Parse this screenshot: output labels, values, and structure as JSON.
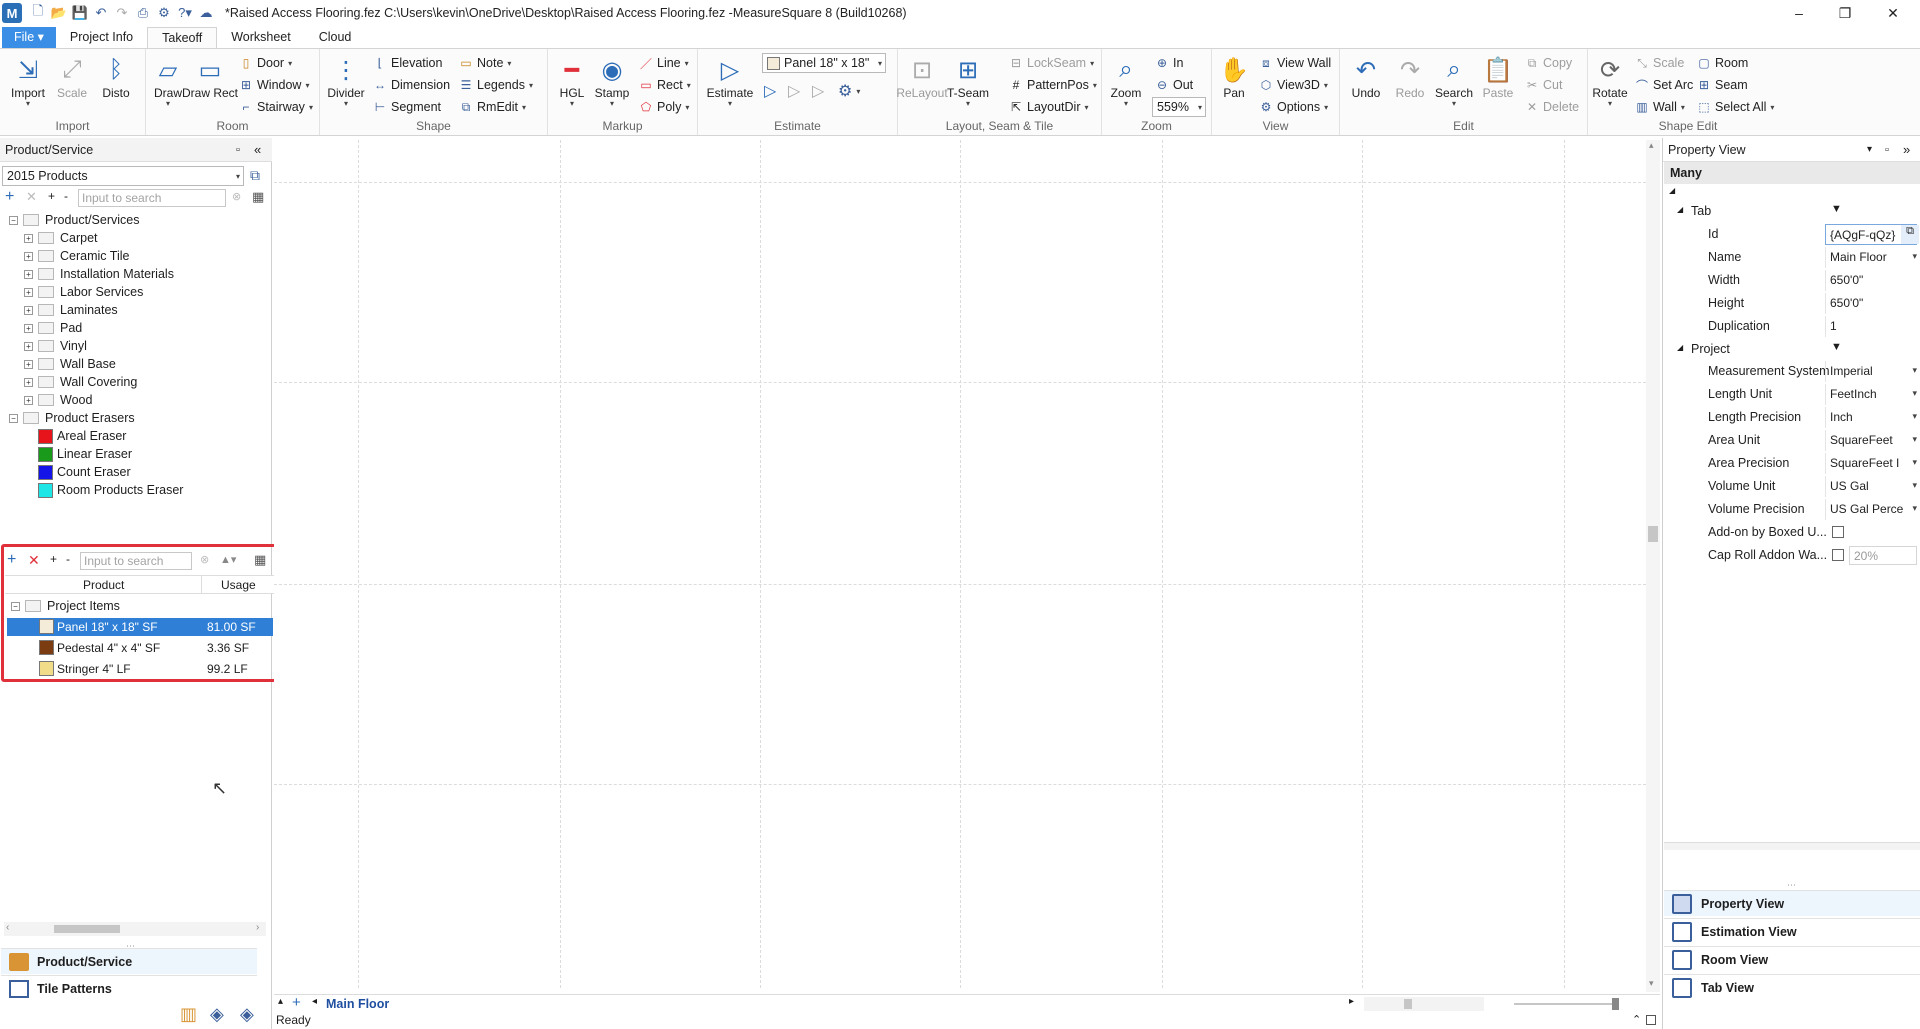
{
  "window": {
    "title": "*Raised Access Flooring.fez C:\\Users\\kevin\\OneDrive\\Desktop\\Raised Access Flooring.fez -MeasureSquare 8 (Build10268)",
    "app_icon": "M"
  },
  "menu": {
    "file": "File ▾",
    "tabs": [
      "Project Info",
      "Takeoff",
      "Worksheet",
      "Cloud"
    ]
  },
  "ribbon": {
    "import": {
      "import": "Import",
      "scale": "Scale",
      "disto": "Disto",
      "group": "Import"
    },
    "room": {
      "draw": "Draw",
      "draw_rect": "Draw Rect",
      "door": "Door",
      "window": "Window",
      "stairway": "Stairway",
      "group": "Room"
    },
    "shape": {
      "divider": "Divider",
      "elevation": "Elevation",
      "dimension": "Dimension",
      "segment": "Segment",
      "note": "Note",
      "legends": "Legends",
      "rmedit": "RmEdit",
      "group": "Shape"
    },
    "markup": {
      "hgl": "HGL",
      "stamp": "Stamp",
      "line": "Line",
      "rect": "Rect",
      "poly": "Poly",
      "group": "Markup"
    },
    "estimate": {
      "estimate": "Estimate",
      "product_combo": "Panel 18\" x 18\"",
      "group": "Estimate"
    },
    "layout": {
      "relayout": "ReLayout",
      "tseam": "T-Seam",
      "lockseam": "LockSeam",
      "patternpos": "PatternPos",
      "layoutdir": "LayoutDir",
      "group": "Layout, Seam & Tile"
    },
    "zoom": {
      "zoom": "Zoom",
      "in": "In",
      "out": "Out",
      "level": "559%",
      "group": "Zoom"
    },
    "view": {
      "pan": "Pan",
      "view_wall": "View Wall",
      "view3d": "View3D",
      "options": "Options",
      "group": "View"
    },
    "edit": {
      "undo": "Undo",
      "redo": "Redo",
      "search": "Search",
      "paste": "Paste",
      "copy": "Copy",
      "cut": "Cut",
      "delete": "Delete",
      "group": "Edit"
    },
    "shape_edit": {
      "rotate": "Rotate",
      "scale": "Scale",
      "set_arc": "Set Arc",
      "wall": "Wall",
      "room": "Room",
      "seam": "Seam",
      "select_all": "Select All",
      "group": "Shape Edit"
    }
  },
  "left_pane": {
    "title": "Product/Service",
    "catalog": "2015 Products",
    "search_placeholder": "Input to search",
    "tree_root": "Product/Services",
    "categories": [
      "Carpet",
      "Ceramic Tile",
      "Installation Materials",
      "Labor Services",
      "Laminates",
      "Pad",
      "Vinyl",
      "Wall Base",
      "Wall Covering",
      "Wood"
    ],
    "erasers_root": "Product Erasers",
    "erasers": [
      {
        "name": "Areal Eraser",
        "color": "#e8141b"
      },
      {
        "name": "Linear Eraser",
        "color": "#1a9a1a"
      },
      {
        "name": "Count Eraser",
        "color": "#1414e8"
      },
      {
        "name": "Room Products Eraser",
        "color": "#1ee6e6"
      }
    ],
    "project": {
      "search_placeholder": "Input to search",
      "col_product": "Product",
      "col_usage": "Usage",
      "root": "Project Items",
      "items": [
        {
          "name": "Panel 18\" x 18\" SF",
          "usage": "81.00 SF",
          "color": "#f4ecd8"
        },
        {
          "name": "Pedestal 4\" x 4\" SF",
          "usage": "3.36 SF",
          "color": "#7a3c10"
        },
        {
          "name": "Stringer 4\" LF",
          "usage": "99.2 LF",
          "color": "#f1dc8a"
        }
      ]
    },
    "bottom_tabs": [
      "Product/Service",
      "Tile Patterns"
    ]
  },
  "right_pane": {
    "title": "Property View",
    "selection": "Many",
    "tab_section": "Tab",
    "project_section": "Project",
    "tab_props": [
      {
        "label": "Id",
        "value": "{AQgF-qQz}"
      },
      {
        "label": "Name",
        "value": "Main Floor",
        "dropdown": true
      },
      {
        "label": "Width",
        "value": "650'0\""
      },
      {
        "label": "Height",
        "value": "650'0\""
      },
      {
        "label": "Duplication",
        "value": "1"
      }
    ],
    "project_props": [
      {
        "label": "Measurement System",
        "value": "Imperial",
        "dropdown": true
      },
      {
        "label": "Length Unit",
        "value": "FeetInch",
        "dropdown": true
      },
      {
        "label": "Length Precision",
        "value": "Inch",
        "dropdown": true
      },
      {
        "label": "Area Unit",
        "value": "SquareFeet",
        "dropdown": true
      },
      {
        "label": "Area Precision",
        "value": "SquareFeet I",
        "dropdown": true
      },
      {
        "label": "Volume Unit",
        "value": "US Gal",
        "dropdown": true
      },
      {
        "label": "Volume Precision",
        "value": "US Gal Perce",
        "dropdown": true
      },
      {
        "label": "Add-on by Boxed U...",
        "value": "",
        "checkbox": true
      },
      {
        "label": "Cap Roll Addon Wa...",
        "value": "20%",
        "checkbox": true
      }
    ],
    "nav": [
      "Property View",
      "Estimation View",
      "Room View",
      "Tab View"
    ]
  },
  "sheet": {
    "active_tab": "Main Floor"
  },
  "status": {
    "text": "Ready"
  }
}
